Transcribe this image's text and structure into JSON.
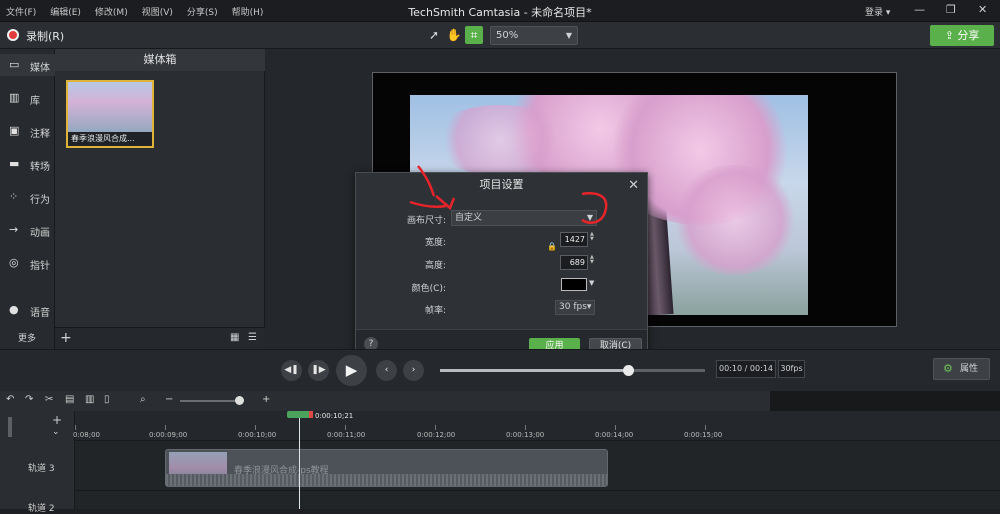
{
  "menubar": {
    "items": [
      "文件(F)",
      "编辑(E)",
      "修改(M)",
      "视图(V)",
      "分享(S)",
      "帮助(H)"
    ],
    "title": "TechSmith Camtasia - 未命名项目*",
    "login": "登录 ▾"
  },
  "toolbar": {
    "record_label": "录制(R)",
    "zoom_value": "50%",
    "share_label": "分享"
  },
  "leftnav": {
    "items": [
      {
        "label": "媒体",
        "icon": "media-icon"
      },
      {
        "label": "库",
        "icon": "library-icon"
      },
      {
        "label": "注释",
        "icon": "annotation-icon"
      },
      {
        "label": "转场",
        "icon": "transition-icon"
      },
      {
        "label": "行为",
        "icon": "behavior-icon"
      },
      {
        "label": "动画",
        "icon": "animation-icon"
      },
      {
        "label": "指针",
        "icon": "cursor-icon"
      },
      {
        "label": "语音",
        "icon": "voice-icon"
      }
    ],
    "more_label": "更多"
  },
  "bin": {
    "title": "媒体箱",
    "media": [
      {
        "name": "春季浪漫风合成..."
      }
    ]
  },
  "dialog": {
    "title": "项目设置",
    "canvas_size_label": "画布尺寸:",
    "canvas_size_value": "自定义",
    "width_label": "宽度:",
    "width_value": "1427",
    "height_label": "高度:",
    "height_value": "689",
    "color_label": "颜色(C):",
    "color_value": "#000000",
    "framerate_label": "帧率:",
    "framerate_value": "30 fps▾",
    "help_label": "?",
    "apply_label": "应用",
    "cancel_label": "取消(C)"
  },
  "playback": {
    "timecode": "00:10 / 00:14",
    "fps": "30fps",
    "properties_label": "属性",
    "progress": 0.71
  },
  "timeline": {
    "playhead_time": "0:00:10;21",
    "ticks": [
      "0:08;00",
      "0:00:09;00",
      "0:00:10;00",
      "0:00:11;00",
      "0:00:12;00",
      "0:00:13;00",
      "0:00:14;00",
      "0:00:15;00"
    ],
    "tracks": [
      {
        "label": "轨道 3"
      },
      {
        "label": "轨道 2"
      }
    ],
    "clip_name": "春季浪漫风合成-ps教程"
  },
  "colors": {
    "accent_green": "#5ab04a",
    "record_red": "#e23b3b",
    "selection_gold": "#e0b43a",
    "annotation_red": "#e8242a"
  }
}
